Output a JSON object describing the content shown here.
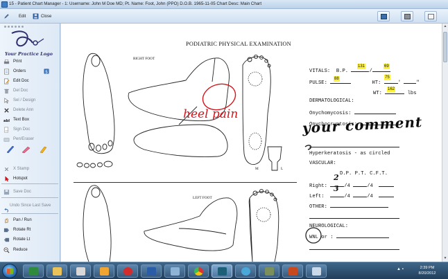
{
  "window": {
    "title": "15 - Patient Chart Manager - 1: Username: John M  Doe  MD; Pt. Name: Foot, John (PPO)  D.O.B. 1965-11-05 Chart Desc: Main Chart"
  },
  "toolbar": {
    "edit_label": "Edit",
    "close_label": "Close"
  },
  "sidebar": {
    "logo_text": "Your Practice Logo",
    "items": [
      {
        "label": "Print",
        "icon": "printer-icon"
      },
      {
        "label": "Orders",
        "icon": "orders-icon"
      },
      {
        "label": "Edit Doc",
        "icon": "edit-doc-icon"
      },
      {
        "label": "Del Doc",
        "icon": "trash-icon"
      },
      {
        "label": "Sel / Design",
        "icon": "pointer-icon"
      },
      {
        "label": "Delete Ann",
        "icon": "x-icon"
      },
      {
        "label": "Text Box",
        "icon": "text-box-icon"
      },
      {
        "label": "Sign Doc",
        "icon": "sign-icon"
      },
      {
        "label": "Pen/Eraser",
        "icon": "pen-eraser-icon"
      },
      {
        "label": "X Stamp",
        "icon": "x-stamp-icon"
      },
      {
        "label": "Hotspot",
        "icon": "hotspot-icon"
      },
      {
        "label": "Save Doc",
        "icon": "save-icon"
      },
      {
        "label": "Undo Since Last Save",
        "icon": "undo-icon"
      },
      {
        "label": "Pan / Run",
        "icon": "pan-icon"
      },
      {
        "label": "Rotate Rt",
        "icon": "rotate-right-icon"
      },
      {
        "label": "Rotate Lt",
        "icon": "rotate-left-icon"
      },
      {
        "label": "Reduce",
        "icon": "reduce-icon"
      }
    ]
  },
  "document": {
    "title": "PODIATRIC PHYSICAL EXAMINATION",
    "right_foot_label": "RIGHT FOOT",
    "left_foot_label": "LEFT FOOT",
    "small_label_m": "M",
    "small_label_l": "L",
    "form": {
      "vitals_label": "VITALS:",
      "bp_label": "B.P.",
      "bp_slash": "/",
      "bp_sys": "131",
      "bp_dia": "69",
      "pulse_label": "PULSE:",
      "pulse_value": "88",
      "ht_label": "HT:",
      "ht_value": "75",
      "ht_unit": "'",
      "ht_unit2": "\"",
      "wt_label": "WT:",
      "wt_value": "162",
      "wt_unit": "lbs",
      "dermatological": "DERMATOLOGICAL:",
      "onychomycosis": "Onychomycosis:",
      "onychocryptosis": "Onychocryptosis:",
      "hyperkeratosis": "Hyperkeratosis - as circled",
      "vascular": "VASCULAR:",
      "vascular_headers": "D.P.   P.T.   C.F.T.",
      "right_label": "Right:",
      "left_label": "Left:",
      "per4a": "/4",
      "per4b": "/4",
      "per4c": "/4",
      "per4d": "/4",
      "other_label": "OTHER:",
      "neurological": "NEUROLOGICAL:",
      "wnl": "WNL",
      "or_text": "or :"
    },
    "annotations": {
      "heel_pain": "heel pain",
      "comment": "your comment",
      "right_dp": "2",
      "left_dp": "3"
    }
  },
  "taskbar": {
    "time": "2:39 PM",
    "date": "8/20/2012"
  },
  "colors": {
    "annotation_red": "#d4141b",
    "highlight": "#fff23a",
    "taskbar": "#2c4b6b"
  }
}
